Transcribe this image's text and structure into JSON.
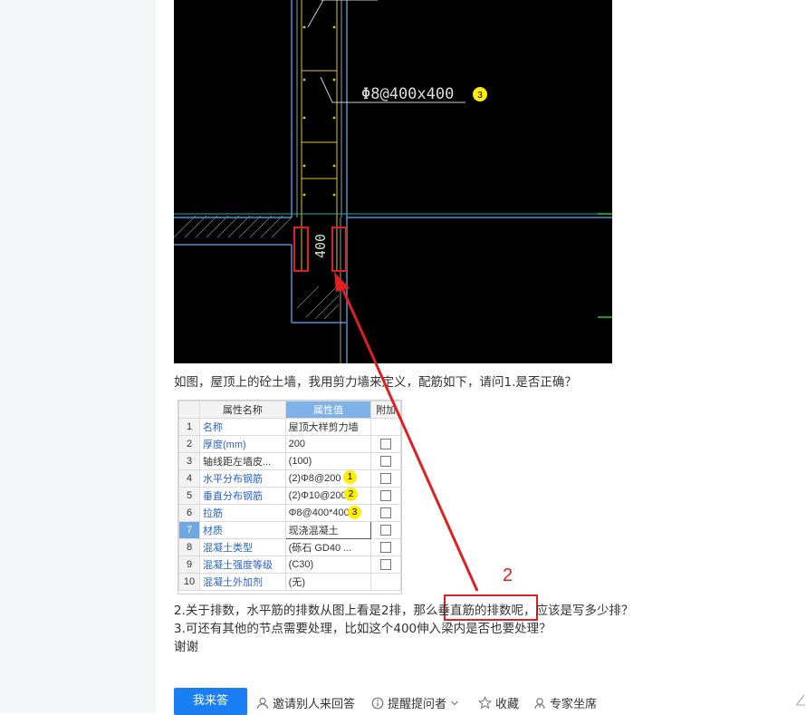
{
  "cad": {
    "annotation": "Φ8@400x400",
    "dimension": "400",
    "badge": "3"
  },
  "question": {
    "line1": "如图，屋顶上的砼土墙，我用剪力墙来定义，配筋如下，请问1.是否正确？",
    "line2": "2.关于排数，水平筋的排数从图上看是2排，那么垂直筋的排数呢，应该是写多少排？",
    "line3": "3.可还有其他的节点需要处理，比如这个400伸入梁内是否也要处理？",
    "line4": "谢谢",
    "callout_number": "2"
  },
  "properties": {
    "headers": {
      "name": "属性名称",
      "value": "属性值",
      "extra": "附加"
    },
    "rows": [
      {
        "idx": "1",
        "name": "名称",
        "value": "屋顶大样剪力墙"
      },
      {
        "idx": "2",
        "name": "厚度(mm)",
        "value": "200"
      },
      {
        "idx": "3",
        "name": "轴线距左墙皮...",
        "value": "(100)"
      },
      {
        "idx": "4",
        "name": "水平分布钢筋",
        "value": "(2)Φ8@200",
        "badge": "1"
      },
      {
        "idx": "5",
        "name": "垂直分布钢筋",
        "value": "(2)Φ10@200",
        "badge": "2"
      },
      {
        "idx": "6",
        "name": "拉筋",
        "value": "Φ8@400*400",
        "badge": "3"
      },
      {
        "idx": "7",
        "name": "材质",
        "value": "现浇混凝土"
      },
      {
        "idx": "8",
        "name": "混凝土类型",
        "value": "(砾石 GD40 ..."
      },
      {
        "idx": "9",
        "name": "混凝土强度等级",
        "value": "(C30)"
      },
      {
        "idx": "10",
        "name": "混凝土外加剂",
        "value": "(无)"
      }
    ]
  },
  "actions": {
    "answer": "我来答",
    "invite": "邀请别人来回答",
    "remind": "提醒提问者",
    "favorite": "收藏",
    "expert": "专家坐席"
  },
  "colors": {
    "accent": "#1a7ff5",
    "annotation_red": "#e02020",
    "badge_yellow": "#ffee00"
  }
}
